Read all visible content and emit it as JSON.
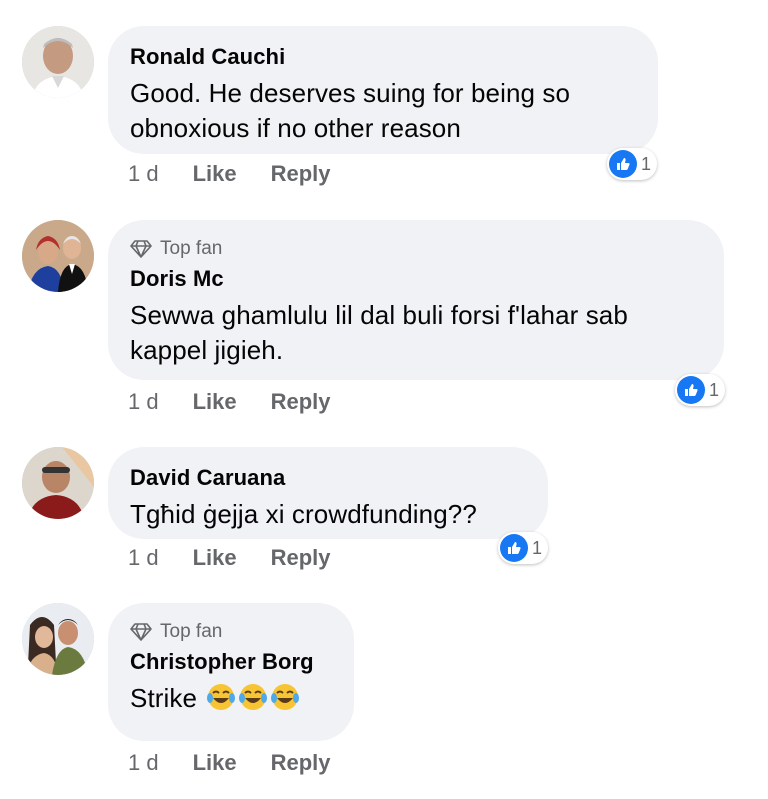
{
  "comments": [
    {
      "author": "Ronald Cauchi",
      "top_fan": false,
      "text_lines": [
        "Good. He deserves suing for being so",
        "obnoxious if no other reason"
      ],
      "time": "1 d",
      "like_label": "Like",
      "reply_label": "Reply",
      "reaction_count": "1"
    },
    {
      "badge": "Top fan",
      "author": "Doris Mc",
      "top_fan": true,
      "text_lines": [
        "Sewwa ghamlulu lil dal buli forsi f'lahar sab",
        "kappel jigieh."
      ],
      "time": "1 d",
      "like_label": "Like",
      "reply_label": "Reply",
      "reaction_count": "1"
    },
    {
      "author": "David Caruana",
      "top_fan": false,
      "text_lines": [
        "Tgħid ġejja xi crowdfunding??"
      ],
      "time": "1 d",
      "like_label": "Like",
      "reply_label": "Reply",
      "reaction_count": "1"
    },
    {
      "badge": "Top fan",
      "author": "Christopher Borg",
      "top_fan": true,
      "text_lines": [
        "Strike"
      ],
      "emoji": "tears-of-joy-emoji x3",
      "time": "1 d",
      "like_label": "Like",
      "reply_label": "Reply"
    }
  ],
  "colors": {
    "bubble": "#f0f2f5",
    "secondary_text": "#65676b",
    "like_blue": "#1877f2"
  },
  "icons": [
    "diamond-icon",
    "thumbs-up-icon",
    "tears-of-joy-emoji"
  ]
}
